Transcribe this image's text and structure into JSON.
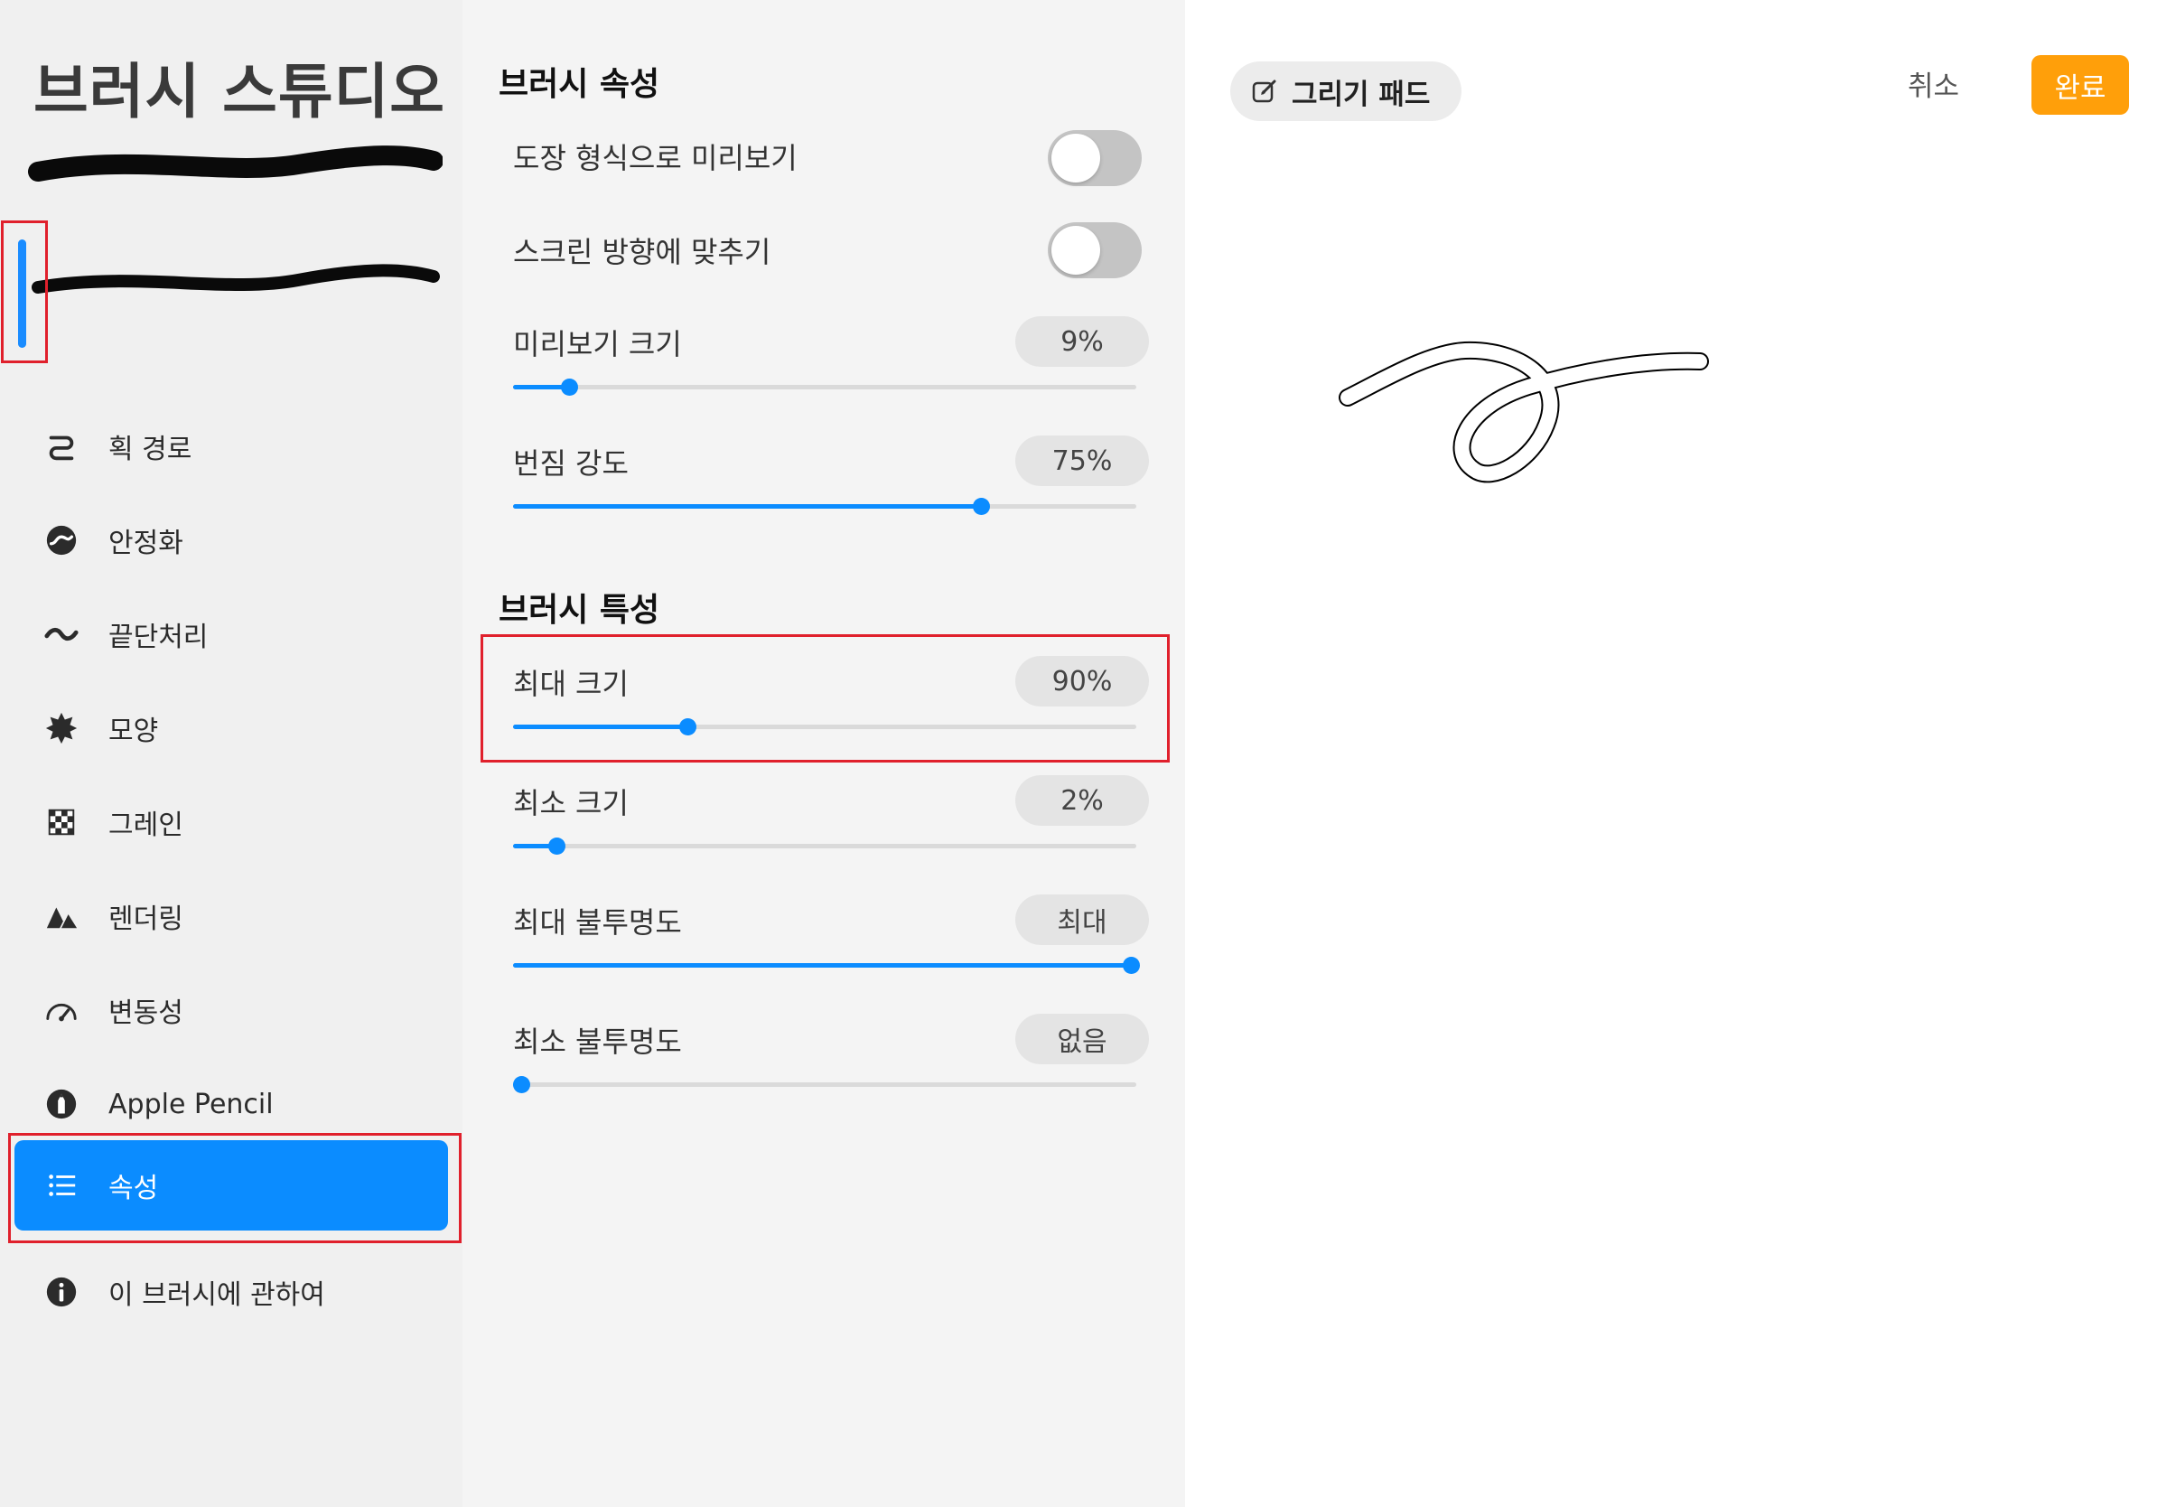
{
  "sidebar": {
    "title": "브러시 스튜디오",
    "items": [
      {
        "label": "획 경로",
        "icon": "stroke-path-icon"
      },
      {
        "label": "안정화",
        "icon": "stabilization-icon"
      },
      {
        "label": "끝단처리",
        "icon": "taper-icon"
      },
      {
        "label": "모양",
        "icon": "shape-icon"
      },
      {
        "label": "그레인",
        "icon": "grain-icon"
      },
      {
        "label": "렌더링",
        "icon": "rendering-icon"
      },
      {
        "label": "변동성",
        "icon": "dynamics-icon"
      },
      {
        "label": "Apple Pencil",
        "icon": "apple-pencil-icon"
      },
      {
        "label": "속성",
        "icon": "list-icon",
        "active": true
      },
      {
        "label": "이 브러시에 관하여",
        "icon": "info-icon"
      }
    ]
  },
  "brush_properties": {
    "title": "브러시 속성",
    "stamp_preview": {
      "label": "도장 형식으로 미리보기",
      "on": false
    },
    "orient_to_screen": {
      "label": "스크린 방향에 맞추기",
      "on": false
    },
    "preview_size": {
      "label": "미리보기 크기",
      "value": "9%",
      "level": 0.09
    },
    "smudge": {
      "label": "번짐 강도",
      "value": "75%",
      "level": 0.75
    }
  },
  "brush_behavior": {
    "title": "브러시 특성",
    "max_size": {
      "label": "최대 크기",
      "value": "90%",
      "level": 0.28
    },
    "min_size": {
      "label": "최소 크기",
      "value": "2%",
      "level": 0.07
    },
    "max_opacity": {
      "label": "최대 불투명도",
      "value": "최대",
      "level": 1.0
    },
    "min_opacity": {
      "label": "최소 불투명도",
      "value": "없음",
      "level": 0.0
    }
  },
  "canvas": {
    "pad_label": "그리기 패드",
    "pad_icon": "edit-icon",
    "cancel_label": "취소",
    "done_label": "완료"
  },
  "colors": {
    "accent": "#0b8cff",
    "done": "#ff9f0a",
    "highlight": "#e0202c"
  }
}
